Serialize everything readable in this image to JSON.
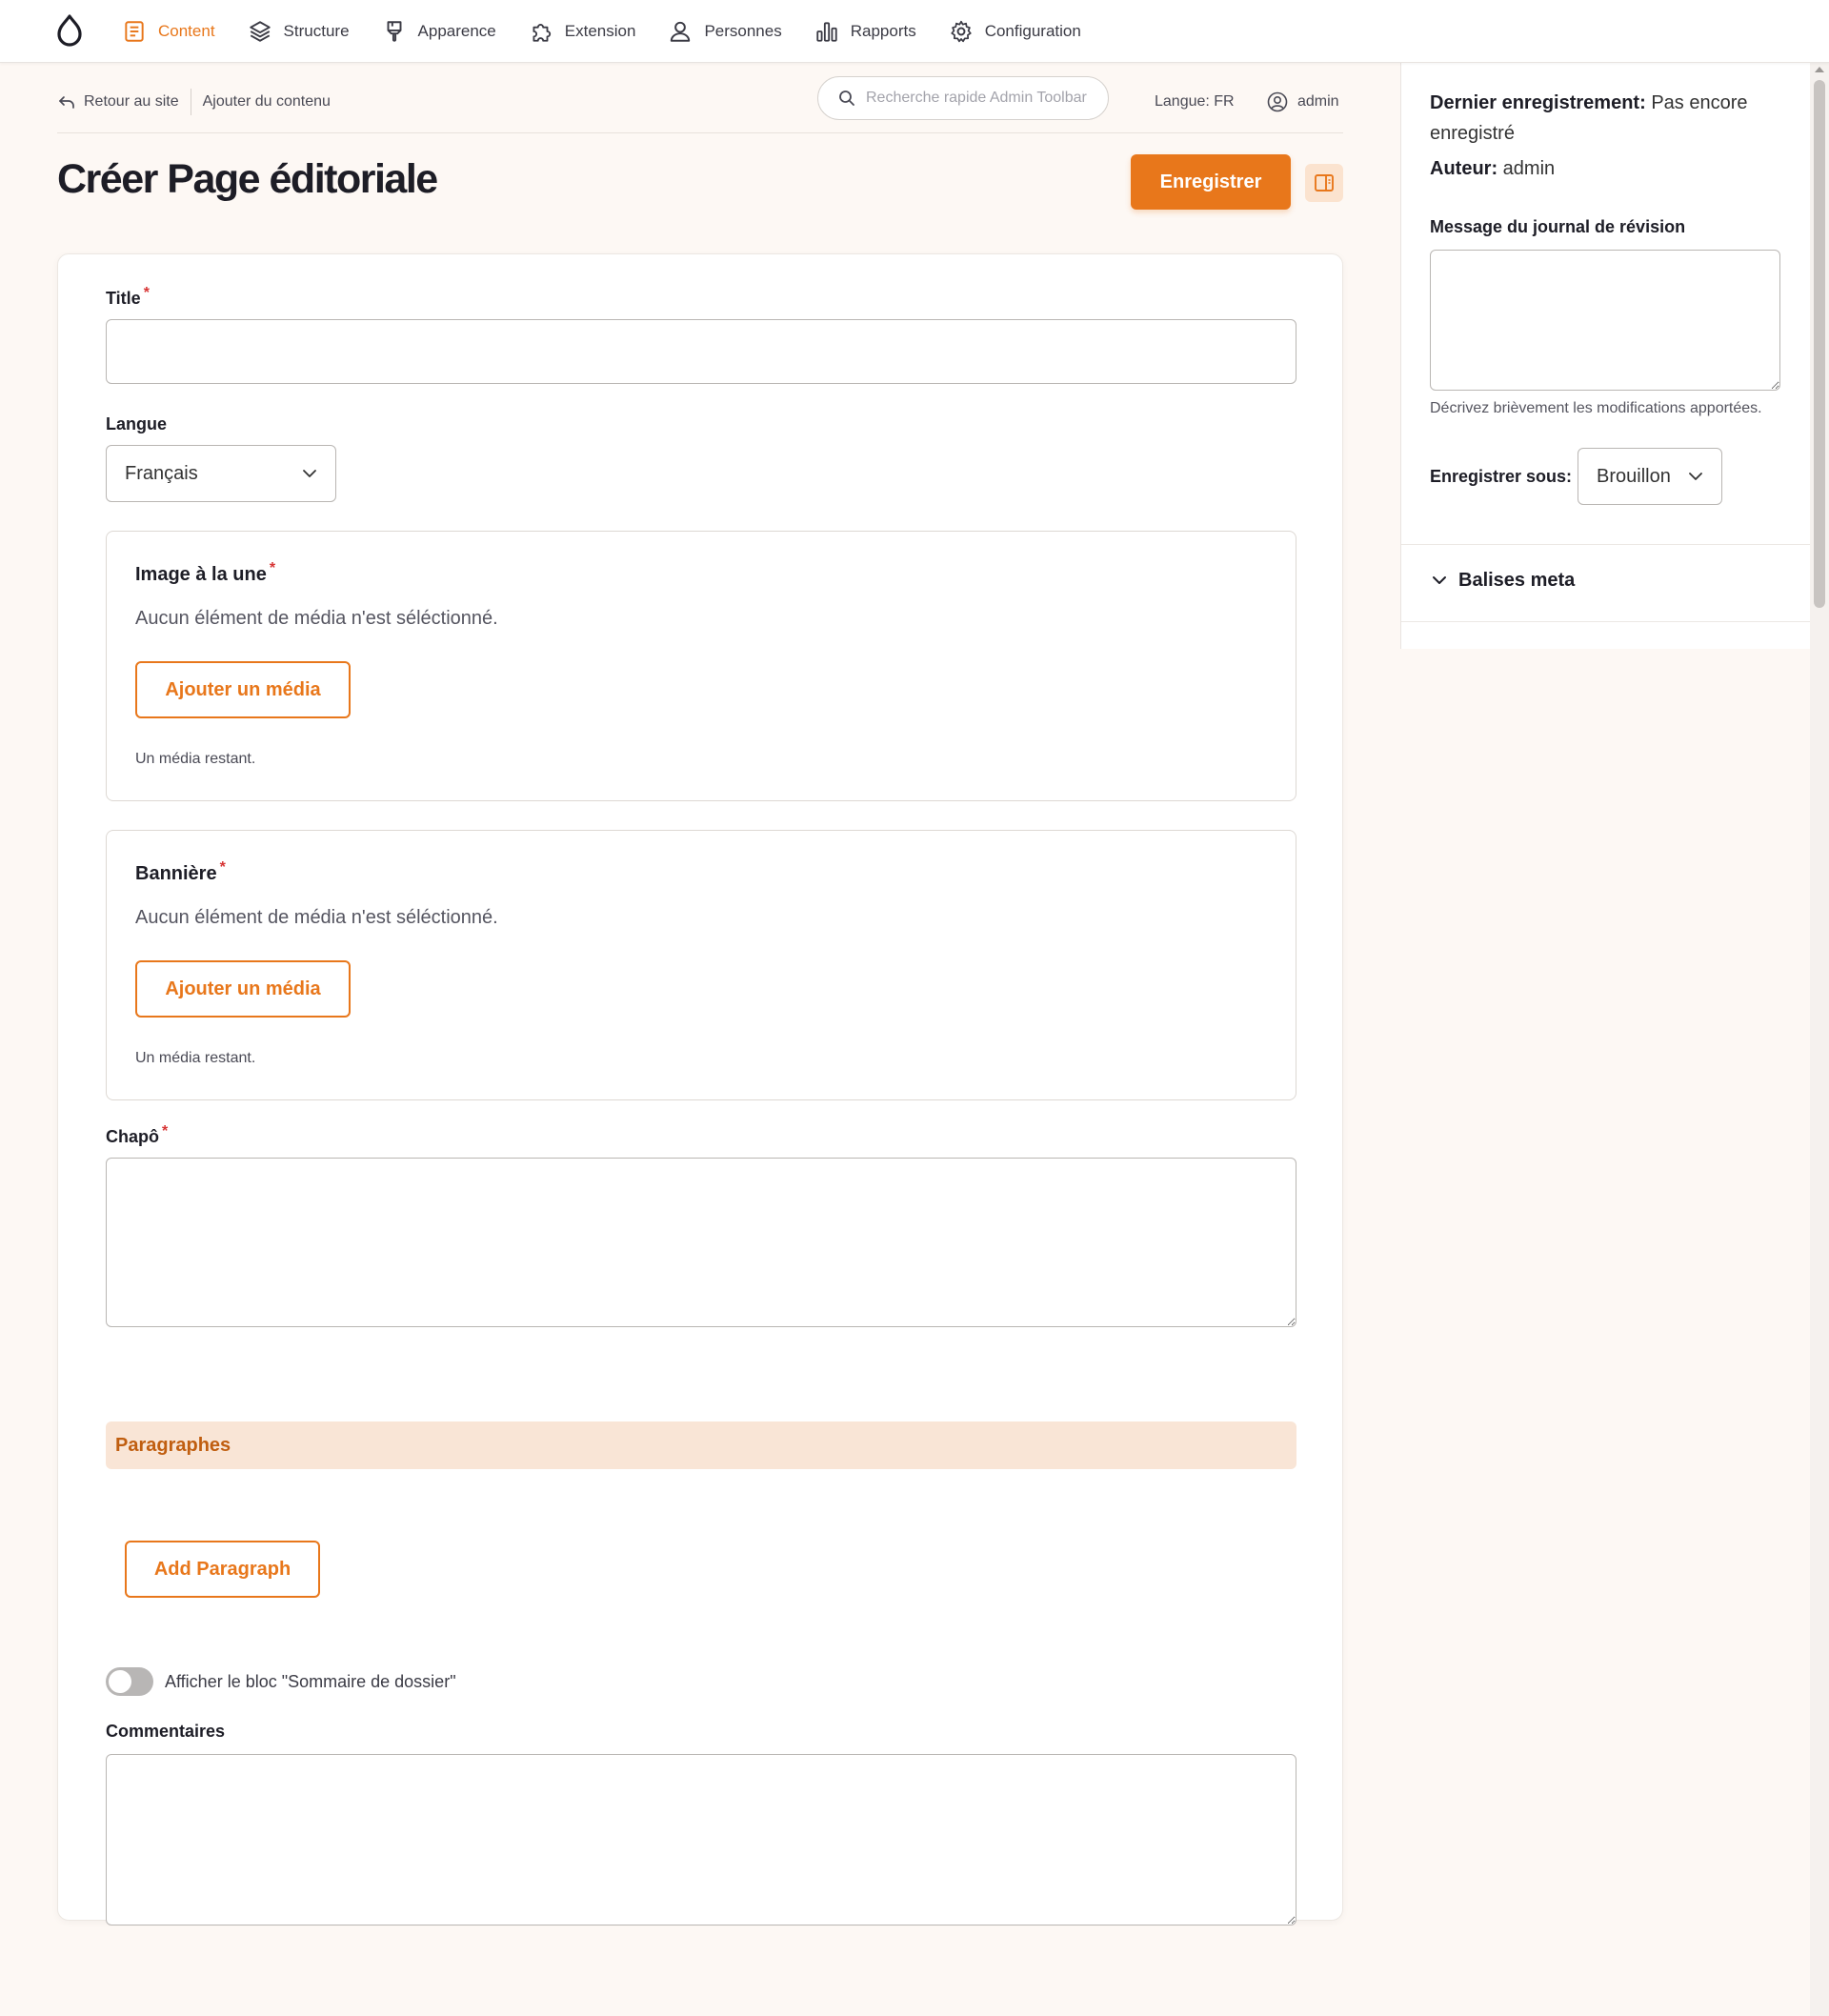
{
  "toolbar": {
    "nav": [
      {
        "label": "Content",
        "icon": "content-icon"
      },
      {
        "label": "Structure",
        "icon": "structure-icon"
      },
      {
        "label": "Apparence",
        "icon": "brush-icon"
      },
      {
        "label": "Extension",
        "icon": "puzzle-icon"
      },
      {
        "label": "Personnes",
        "icon": "person-icon"
      },
      {
        "label": "Rapports",
        "icon": "bar-chart-icon"
      },
      {
        "label": "Configuration",
        "icon": "gear-icon"
      }
    ],
    "accent": "#e8771b"
  },
  "header": {
    "back_link": "Retour au site",
    "add_content_link": "Ajouter du contenu",
    "search_placeholder": "Recherche rapide Admin Toolbar",
    "language": "Langue: FR",
    "user": "admin",
    "page_title": "Créer Page éditoriale",
    "save_button": "Enregistrer"
  },
  "form": {
    "title_label": "Title",
    "title_value": "",
    "langue_label": "Langue",
    "langue_value": "Français",
    "image_une": {
      "label": "Image à la une",
      "empty_text": "Aucun élément de média n'est séléctionné.",
      "button": "Ajouter un média",
      "remaining": "Un média restant."
    },
    "banniere": {
      "label": "Bannière",
      "empty_text": "Aucun élément de média n'est séléctionné.",
      "button": "Ajouter un média",
      "remaining": "Un média restant."
    },
    "chapo_label": "Chapô",
    "paragraphs_label": "Paragraphes",
    "add_paragraph": "Add Paragraph",
    "toggle_label": "Afficher le bloc \"Sommaire de dossier\"",
    "toggle_on": false,
    "comments_label": "Commentaires"
  },
  "sidebar": {
    "last_saved_label": "Dernier enregistrement:",
    "last_saved_value": "Pas encore enregistré",
    "author_label": "Auteur:",
    "author_value": "admin",
    "revision_label": "Message du journal de révision",
    "revision_help": "Décrivez brièvement les modifications apportées.",
    "save_as_label": "Enregistrer sous:",
    "save_as_value": "Brouillon",
    "meta_label": "Balises meta"
  }
}
